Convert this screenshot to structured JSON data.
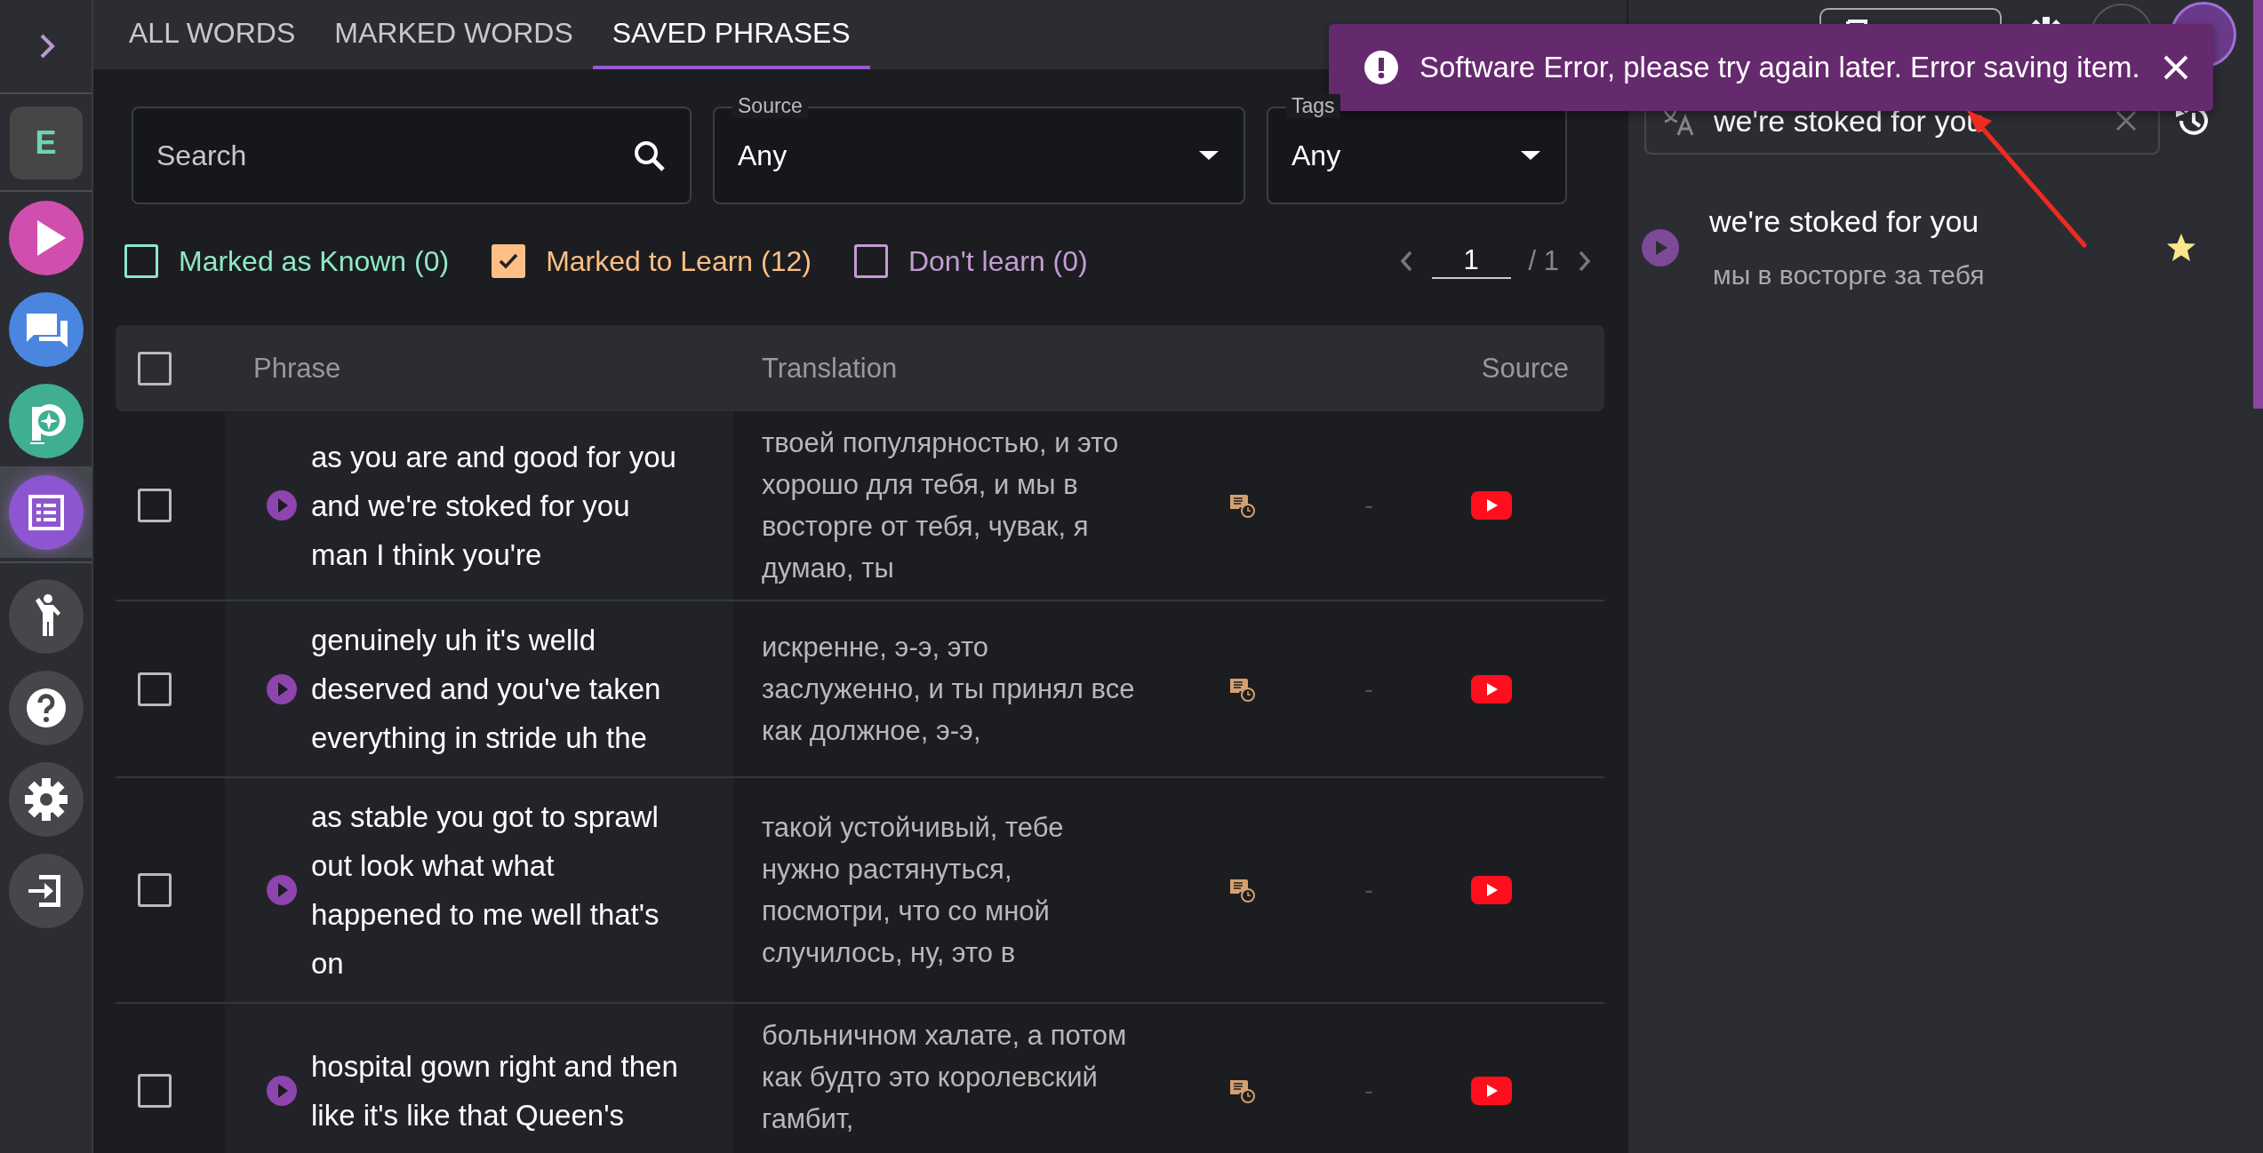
{
  "sidebar": {
    "brand_letter": "E",
    "nav": [
      {
        "color": "#d04fae",
        "selected": false
      },
      {
        "color": "#4a85e0",
        "selected": false
      },
      {
        "color": "#3fae92",
        "selected": false
      },
      {
        "color": "#8e55d0",
        "selected": true
      },
      {
        "color": "#46474b",
        "selected": false
      },
      {
        "color": "#46474b",
        "selected": false
      },
      {
        "color": "#46474b",
        "selected": false
      },
      {
        "color": "#46474b",
        "selected": false
      }
    ]
  },
  "tabs": [
    {
      "label": "ALL WORDS",
      "selected": false
    },
    {
      "label": "MARKED WORDS",
      "selected": false
    },
    {
      "label": "SAVED PHRASES",
      "selected": true
    }
  ],
  "filters": {
    "search": {
      "placeholder": "Search"
    },
    "source": {
      "label": "Source",
      "value": "Any"
    },
    "tags": {
      "label": "Tags",
      "value": "Any"
    }
  },
  "status_filters": [
    {
      "label": "Marked as Known (0)",
      "checked": false,
      "color": "#8fe8c8"
    },
    {
      "label": "Marked to Learn (12)",
      "checked": true,
      "color": "#fdbf85"
    },
    {
      "label": "Don't learn (0)",
      "checked": false,
      "color": "#c49bd4"
    }
  ],
  "pagination": {
    "page": "1",
    "total": "/ 1"
  },
  "table": {
    "select_all": false,
    "columns": [
      "Phrase",
      "Translation",
      "Source"
    ],
    "rows": [
      {
        "checked": false,
        "phrase": "as you are and good for you and we're stoked for you man I think you're",
        "translation": "твоей популярностью, и это хорошо для тебя, и мы в восторге от тебя, чувак, я думаю, ты",
        "column_5": "-"
      },
      {
        "checked": false,
        "phrase": "genuinely uh it's welld deserved and you've taken everything in stride uh the",
        "translation": "искренне, э-э, это заслуженно, и ты принял все как должное, э-э,",
        "column_5": "-"
      },
      {
        "checked": false,
        "phrase": "as stable you got to sprawl out look what what happened to me well that's on",
        "translation": "такой устойчивый, тебе нужно растянуться, посмотри, что со мной случилось, ну, это в",
        "column_5": "-"
      },
      {
        "checked": false,
        "phrase": "hospital gown right and then like it's like that Queen's",
        "translation": "больничном халате, а потом как будто это королевский гамбит,",
        "column_5": "-"
      }
    ]
  },
  "side_panel": {
    "search": {
      "value": "we're stoked for you"
    },
    "results": [
      {
        "phrase": "we're stoked for you",
        "translation": "мы в восторге за тебя",
        "starred": true
      }
    ]
  },
  "toast": {
    "message": "Software Error, please try again later. Error saving item."
  }
}
